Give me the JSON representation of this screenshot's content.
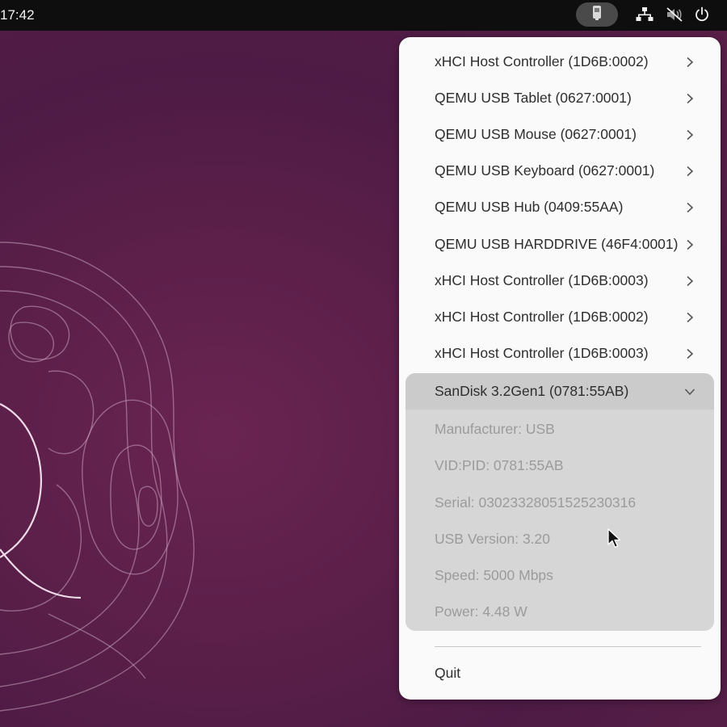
{
  "topbar": {
    "clock": "17:42",
    "icons": [
      "usb-device-icon",
      "network-wired-icon",
      "volume-muted-icon",
      "power-icon"
    ]
  },
  "menu": {
    "devices": [
      {
        "label": "xHCI Host Controller (1D6B:0002)"
      },
      {
        "label": "QEMU USB Tablet (0627:0001)"
      },
      {
        "label": "QEMU USB Mouse (0627:0001)"
      },
      {
        "label": "QEMU USB Keyboard (0627:0001)"
      },
      {
        "label": "QEMU USB Hub (0409:55AA)"
      },
      {
        "label": "QEMU USB HARDDRIVE (46F4:0001)"
      },
      {
        "label": "xHCI Host Controller (1D6B:0003)"
      },
      {
        "label": "xHCI Host Controller (1D6B:0002)"
      },
      {
        "label": "xHCI Host Controller (1D6B:0003)"
      }
    ],
    "expanded": {
      "label": "SanDisk 3.2Gen1 (0781:55AB)",
      "details": [
        "Manufacturer: USB",
        "VID:PID: 0781:55AB",
        "Serial: 03023328051525230316",
        "USB Version: 3.20",
        "Speed: 5000 Mbps",
        "Power: 4.48 W"
      ]
    },
    "quit_label": "Quit"
  },
  "colors": {
    "topbar_bg": "#0e0e0e",
    "menu_bg": "#fafafa",
    "expanded_bg": "#d6d6d6",
    "detail_text": "#9b9b9b",
    "wallpaper": "#5a1f49"
  }
}
